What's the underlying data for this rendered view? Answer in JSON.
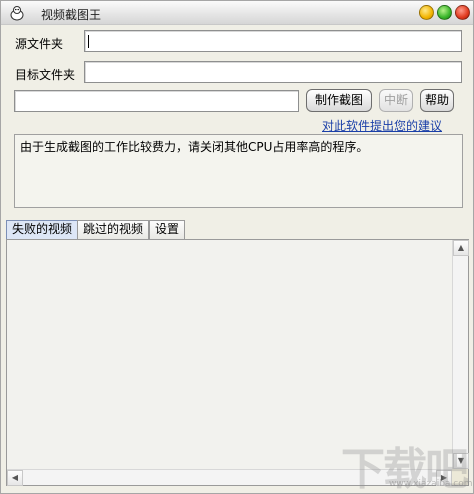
{
  "window": {
    "title": "视频截图王"
  },
  "form": {
    "source_label": "源文件夹",
    "source_value": "",
    "target_label": "目标文件夹",
    "target_value": "",
    "progress_value": ""
  },
  "buttons": {
    "make": "制作截图",
    "stop": "中断",
    "help": "帮助"
  },
  "feedback_link": "对此软件提出您的建议",
  "info_text": "由于生成截图的工作比较费力，请关闭其他CPU占用率高的程序。",
  "tabs": [
    {
      "label": "失败的视频",
      "active": true
    },
    {
      "label": "跳过的视频",
      "active": false
    },
    {
      "label": "设置",
      "active": false
    }
  ],
  "watermark": {
    "main": "下载吧",
    "sub": "www.xiazaiba.com"
  }
}
